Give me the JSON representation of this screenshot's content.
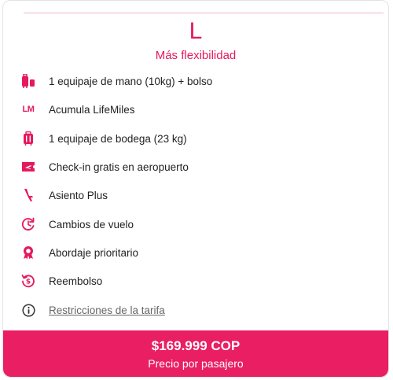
{
  "fare": {
    "letter": "L",
    "subtitle": "Más flexibilidad"
  },
  "benefits": [
    {
      "icon": "luggage-icon",
      "label": "1 equipaje de mano (10kg) + bolso"
    },
    {
      "icon": "lifemiles-icon",
      "label": "Acumula LifeMiles",
      "icon_text": "LM"
    },
    {
      "icon": "suitcase-icon",
      "label": "1 equipaje de bodega (23 kg)"
    },
    {
      "icon": "boarding-pass-icon",
      "label": "Check-in gratis en aeropuerto"
    },
    {
      "icon": "seat-icon",
      "label": "Asiento Plus"
    },
    {
      "icon": "flight-change-icon",
      "label": "Cambios de vuelo"
    },
    {
      "icon": "priority-boarding-icon",
      "label": "Abordaje prioritario"
    },
    {
      "icon": "refund-icon",
      "label": "Reembolso"
    }
  ],
  "restrictions": {
    "icon": "info-icon",
    "label": "Restricciones de la tarifa"
  },
  "price": {
    "amount": "$169.999 COP",
    "note": "Precio por pasajero"
  },
  "colors": {
    "accent": "#e5195e",
    "price_bar": "#e91e63"
  }
}
